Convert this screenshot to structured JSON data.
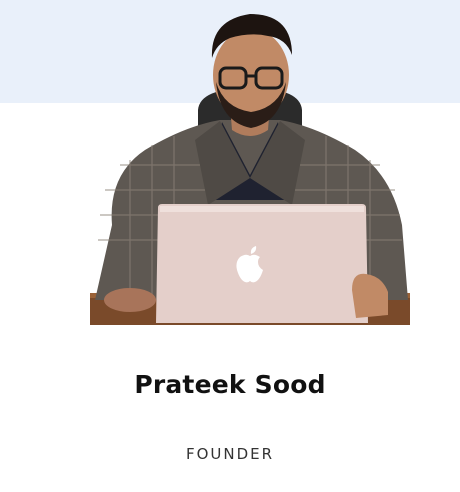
{
  "profile": {
    "name": "Prateek Sood",
    "role": "FOUNDER",
    "photo_icon": "apple-logo-icon"
  },
  "colors": {
    "banner": "#e9f0fa",
    "name_text": "#111111",
    "role_text": "#333333"
  }
}
